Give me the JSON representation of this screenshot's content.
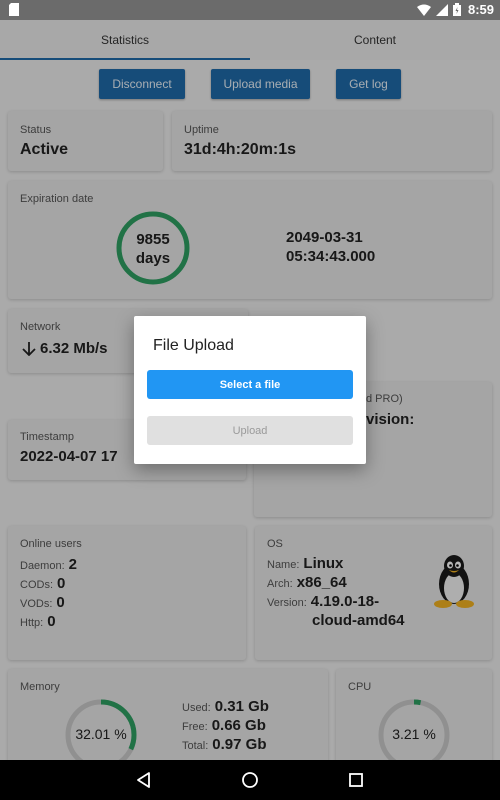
{
  "status_bar": {
    "time": "8:59"
  },
  "tabs": [
    {
      "label": "Statistics",
      "active": true
    },
    {
      "label": "Content",
      "active": false
    }
  ],
  "actions": {
    "disconnect": "Disconnect",
    "upload_media": "Upload media",
    "get_log": "Get log"
  },
  "status_card": {
    "label": "Status",
    "value": "Active"
  },
  "uptime_card": {
    "label": "Uptime",
    "value": "31d:4h:20m:1s"
  },
  "expiration_card": {
    "label": "Expiration date",
    "days_value": "9855",
    "days_unit": "days",
    "date": "2049-03-31",
    "time": "05:34:43.000",
    "ring_color": "#2e9e62"
  },
  "network_card": {
    "label": "Network",
    "value": "6.32 Mb/s"
  },
  "license_card": {
    "partial_label": "d PRO)",
    "partial_value": "vision:"
  },
  "timestamp_card": {
    "label": "Timestamp",
    "value": "2022-04-07 17"
  },
  "online_users_card": {
    "label": "Online users",
    "rows": [
      {
        "label": "Daemon:",
        "value": "2"
      },
      {
        "label": "CODs:",
        "value": "0"
      },
      {
        "label": "VODs:",
        "value": "0"
      },
      {
        "label": "Http:",
        "value": "0"
      }
    ]
  },
  "os_card": {
    "label": "OS",
    "name_label": "Name:",
    "name_value": "Linux",
    "arch_label": "Arch:",
    "arch_value": "x86_64",
    "version_label": "Version:",
    "version_value_1": "4.19.0-18-",
    "version_value_2": "cloud-amd64"
  },
  "memory_card": {
    "label": "Memory",
    "percent_text": "32.01 %",
    "percent": 32.01,
    "used_label": "Used:",
    "used_value": "0.31 Gb",
    "free_label": "Free:",
    "free_value": "0.66 Gb",
    "total_label": "Total:",
    "total_value": "0.97 Gb"
  },
  "cpu_card": {
    "label": "CPU",
    "percent_text": "3.21 %",
    "percent": 3.21
  },
  "dialog": {
    "title": "File Upload",
    "select_button": "Select a file",
    "upload_button": "Upload"
  },
  "colors": {
    "accent": "#1f6aa8",
    "dialog_primary": "#2196f3",
    "gauge_green": "#2e9e62"
  }
}
